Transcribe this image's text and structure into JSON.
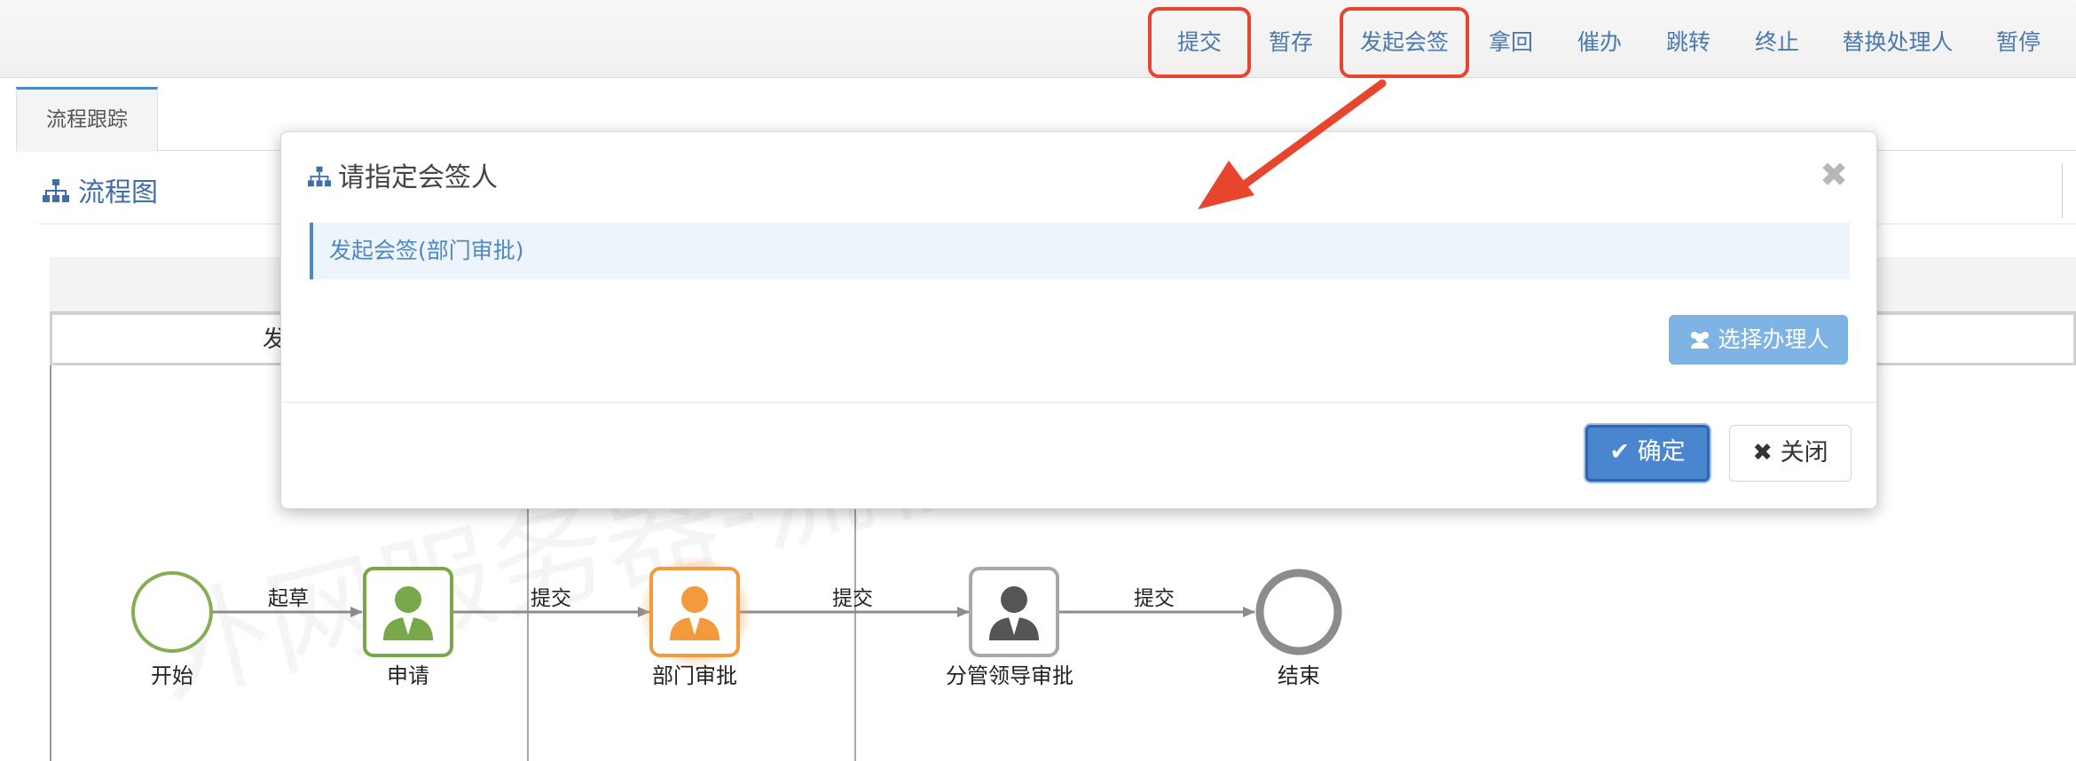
{
  "toolbar": {
    "buttons": [
      "提交",
      "暂存",
      "发起会签",
      "拿回",
      "催办",
      "跳转",
      "终止",
      "替换处理人",
      "暂停"
    ]
  },
  "tabs": [
    "流程跟踪"
  ],
  "panel": {
    "title": "流程图"
  },
  "lane": {
    "header_text": "发"
  },
  "diagram": {
    "nodes": {
      "start": "开始",
      "apply": "申请",
      "dept_approve": "部门审批",
      "leader_approve": "分管领导审批",
      "end": "结束"
    },
    "edges": [
      "起草",
      "提交",
      "提交",
      "提交"
    ]
  },
  "watermark": "外网服务器-流程",
  "modal": {
    "title": "请指定会签人",
    "section": "发起会签(部门审批)",
    "select_button": "选择办理人",
    "ok": "确定",
    "close": "关闭"
  },
  "colors": {
    "accent": "#4a79ad",
    "highlight_box": "#e8452e",
    "node_active": "#f29a3c",
    "node_done": "#79a84a",
    "node_pending": "#8c8c8c",
    "primary_button": "#4a86cf"
  }
}
